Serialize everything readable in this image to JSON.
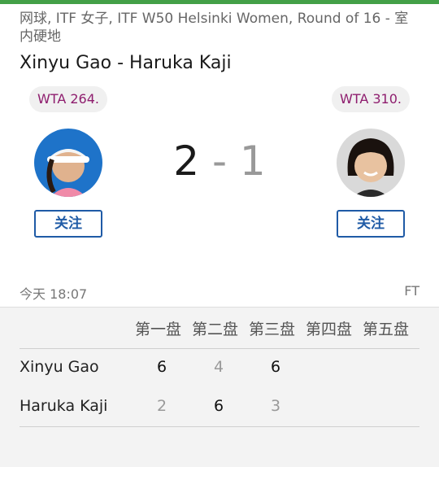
{
  "header": {
    "breadcrumb": "网球, ITF 女子, ITF W50 Helsinki Women, Round of 16 - 室内硬地",
    "title": "Xinyu Gao - Haruka Kaji"
  },
  "home": {
    "rank": "WTA 264.",
    "follow_label": "关注",
    "avatar": "player-photo"
  },
  "away": {
    "rank": "WTA 310.",
    "follow_label": "关注",
    "avatar": "player-photo"
  },
  "score": {
    "home": "2",
    "separator": "-",
    "away": "1"
  },
  "meta": {
    "time": "今天 18:07",
    "status": "FT"
  },
  "sets": {
    "headers": [
      "第一盘",
      "第二盘",
      "第三盘",
      "第四盘",
      "第五盘"
    ],
    "rows": [
      {
        "name": "Xinyu Gao",
        "scores": [
          "6",
          "4",
          "6"
        ]
      },
      {
        "name": "Haruka Kaji",
        "scores": [
          "2",
          "6",
          "3"
        ]
      }
    ]
  },
  "colors": {
    "accent": "#43a047",
    "rank_text": "#8e1d6e",
    "button": "#1f5ba6"
  }
}
